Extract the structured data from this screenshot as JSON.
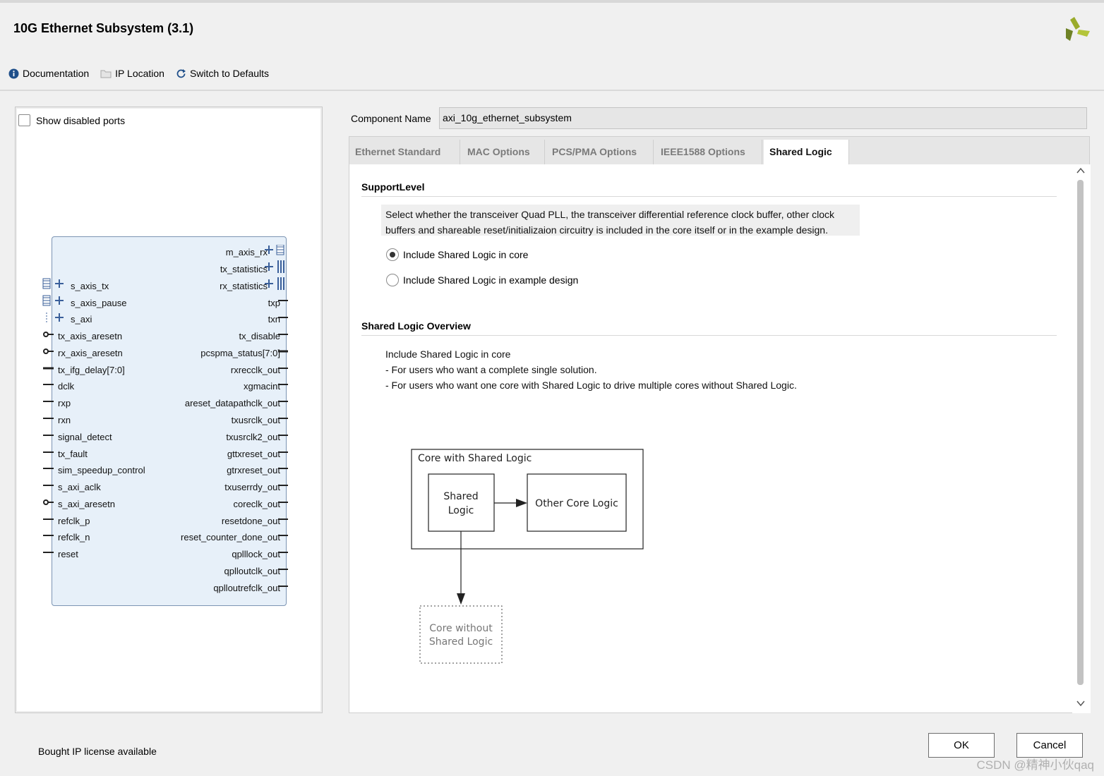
{
  "window": {
    "title": "10G Ethernet Subsystem (3.1)"
  },
  "toolbar": {
    "documentation": "Documentation",
    "ip_location": "IP Location",
    "switch_defaults": "Switch to Defaults"
  },
  "left": {
    "show_disabled_ports": "Show disabled ports",
    "left_ports": [
      "s_axis_tx",
      "s_axis_pause",
      "s_axi",
      "tx_axis_aresetn",
      "rx_axis_aresetn",
      "tx_ifg_delay[7:0]",
      "dclk",
      "rxp",
      "rxn",
      "signal_detect",
      "tx_fault",
      "sim_speedup_control",
      "s_axi_aclk",
      "s_axi_aresetn",
      "refclk_p",
      "refclk_n",
      "reset"
    ],
    "right_ports": [
      "m_axis_rx",
      "tx_statistics",
      "rx_statistics",
      "txp",
      "txn",
      "tx_disable",
      "pcspma_status[7:0]",
      "rxrecclk_out",
      "xgmacint",
      "areset_datapathclk_out",
      "txusrclk_out",
      "txusrclk2_out",
      "gttxreset_out",
      "gtrxreset_out",
      "txuserrdy_out",
      "coreclk_out",
      "resetdone_out",
      "reset_counter_done_out",
      "qplllock_out",
      "qplloutclk_out",
      "qplloutrefclk_out"
    ]
  },
  "component": {
    "label": "Component Name",
    "value": "axi_10g_ethernet_subsystem"
  },
  "tabs": [
    {
      "label": "Ethernet Standard"
    },
    {
      "label": "MAC Options"
    },
    {
      "label": "PCS/PMA Options"
    },
    {
      "label": "IEEE1588 Options"
    },
    {
      "label": "Shared Logic"
    }
  ],
  "support": {
    "heading": "SupportLevel",
    "description_line1": "Select whether the transceiver Quad PLL, the transceiver differential reference clock buffer, other clock",
    "description_line2": "buffers and shareable reset/initializaion circuitry is included in the core itself or in the example design.",
    "option_core": "Include Shared Logic in core",
    "option_example": "Include Shared Logic in example design",
    "selected": "core"
  },
  "overview": {
    "heading": "Shared Logic Overview",
    "line1": "Include Shared Logic in core",
    "line2": "- For users who want a complete single solution.",
    "line3": "- For users who want one core with Shared Logic to drive multiple cores without Shared Logic."
  },
  "diagram": {
    "outer_label": "Core with Shared Logic",
    "shared_line1": "Shared",
    "shared_line2": "Logic",
    "other": "Other Core Logic",
    "without_line1": "Core without",
    "without_line2": "Shared Logic"
  },
  "footer": {
    "license": "Bought IP license available",
    "ok": "OK",
    "cancel": "Cancel",
    "watermark": "CSDN @精神小伙qaq"
  }
}
